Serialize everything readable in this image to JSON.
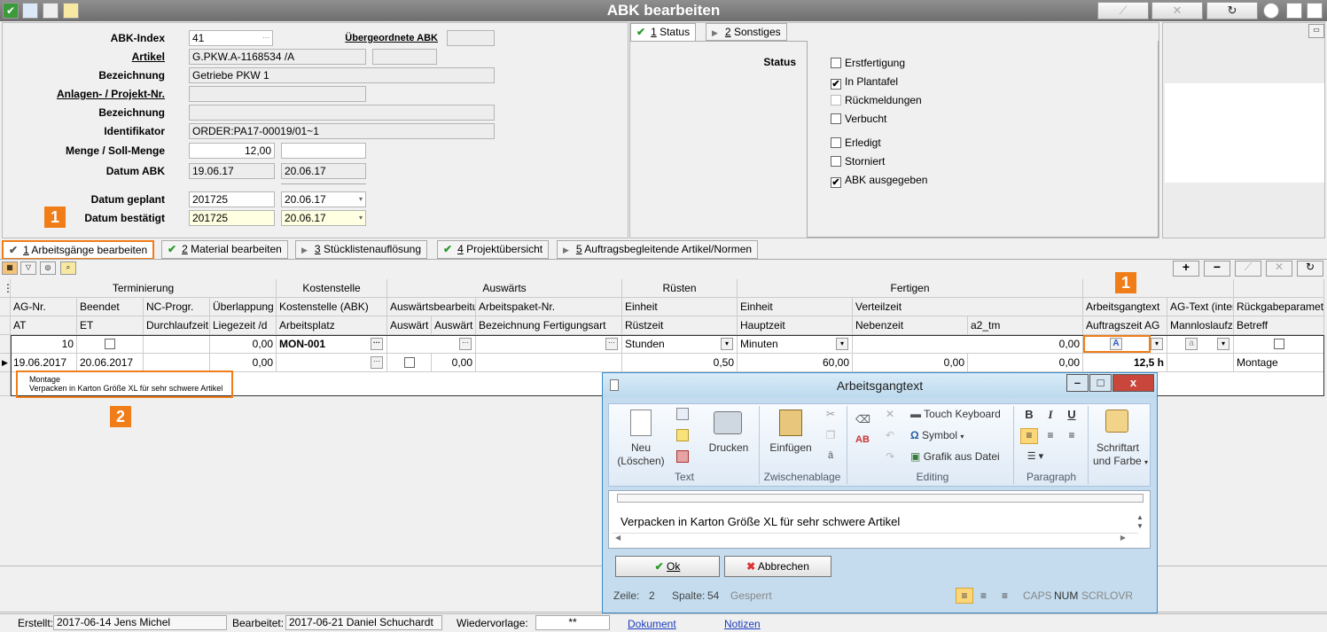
{
  "window": {
    "title": "ABK bearbeiten"
  },
  "form": {
    "abk_index_label": "ABK-Index",
    "abk_index_value": "41",
    "uebergeordnete_label": "Übergeordnete ABK",
    "artikel_label": "Artikel",
    "artikel_value": "G.PKW.A-1168534 /A",
    "bezeichnung_label": "Bezeichnung",
    "bezeichnung_value": "Getriebe PKW 1",
    "anlagen_label": "Anlagen- / Projekt-Nr.",
    "bezeichnung2_label": "Bezeichnung",
    "identifikator_label": "Identifikator",
    "identifikator_value": "ORDER:PA17-00019/01~1",
    "menge_label": "Menge / Soll-Menge",
    "menge_value": "12,00",
    "datum_abk_label": "Datum ABK",
    "datum_abk_1": "19.06.17",
    "datum_abk_2": "20.06.17",
    "datum_geplant_label": "Datum geplant",
    "datum_geplant_1": "201725",
    "datum_geplant_2": "20.06.17",
    "datum_bestaetigt_label": "Datum bestätigt",
    "datum_bestaetigt_1": "201725",
    "datum_bestaetigt_2": "20.06.17",
    "ellipsis": "···"
  },
  "status_tabs": [
    {
      "num": "1",
      "label": " Status"
    },
    {
      "num": "2",
      "label": " Sonstiges"
    }
  ],
  "status": {
    "label": "Status",
    "items": [
      {
        "label": "Erstfertigung",
        "checked": ""
      },
      {
        "label": "In Plantafel",
        "checked": "✔"
      },
      {
        "label": "Rückmeldungen",
        "checked": ""
      },
      {
        "label": "Verbucht",
        "checked": ""
      },
      {
        "label": "Erledigt",
        "checked": ""
      },
      {
        "label": "Storniert",
        "checked": ""
      },
      {
        "label": "ABK ausgegeben",
        "checked": "✔"
      }
    ]
  },
  "main_tabs": [
    {
      "num": "1",
      "label": " Arbeitsgänge bearbeiten"
    },
    {
      "num": "2",
      "label": " Material bearbeiten"
    },
    {
      "num": "3",
      "label": " Stücklistenauflösung"
    },
    {
      "num": "4",
      "label": " Projektübersicht"
    },
    {
      "num": "5",
      "label": " Auftragsbegleitende Artikel/Normen"
    }
  ],
  "grid": {
    "groups": [
      "Terminierung",
      "Kostenstelle",
      "Auswärts",
      "Rüsten",
      "Fertigen"
    ],
    "h1": [
      "AG-Nr.",
      "Beendet",
      "NC-Progr.",
      "Überlappung",
      "Kostenstelle (ABK)",
      "Auswärtsbearbeitung",
      "Arbeitspaket-Nr.",
      "Einheit",
      "Einheit",
      "Verteilzeit",
      "",
      "Arbeitsgangtext",
      "AG-Text (intern)",
      "Rückgabeparameter"
    ],
    "h2": [
      "AT",
      "ET",
      "Durchlaufzeit",
      "Liegezeit /d",
      "Arbeitsplatz",
      "Auswärt",
      "Auswärt",
      "Bezeichnung Fertigungsart",
      "Rüstzeit",
      "Hauptzeit",
      "Nebenzeit",
      "a2_tm",
      "Auftragszeit AG",
      "Mannloslaufzeit",
      "Betreff"
    ],
    "r1": {
      "ag": "10",
      "ueberlappung": "0,00",
      "kostenstelle": "MON-001",
      "ruest_einheit": "Stunden",
      "fert_einheit": "Minuten",
      "verteil": "0,00"
    },
    "r2": {
      "at": "19.06.2017",
      "et": "20.06.2017",
      "liegezeit": "0,00",
      "auswaerts": "0,00",
      "ruestzeit": "0,50",
      "hauptzeit": "60,00",
      "nebenzeit": "0,00",
      "a2": "0,00",
      "auftragszeit": "12,5 h",
      "betreff": "Montage"
    },
    "text_line1": "Montage",
    "text_line2": "Verpacken in Karton Größe XL für sehr schwere Artikel"
  },
  "markers": {
    "m1a": "1",
    "m1b": "1",
    "m2": "2"
  },
  "dialog": {
    "title": "Arbeitsgangtext",
    "neu": "Neu",
    "loeschen": "(Löschen)",
    "drucken": "Drucken",
    "einfuegen": "Einfügen",
    "touch": "Touch Keyboard",
    "symbol": "Symbol",
    "grafik": "Grafik aus Datei",
    "schriftart": "Schriftart",
    "farbe": "und Farbe",
    "groups": {
      "text": "Text",
      "zwischenablage": "Zwischenablage",
      "editing": "Editing",
      "paragraph": "Paragraph"
    },
    "bold": "B",
    "italic": "I",
    "underline": "U",
    "content": "Verpacken in Karton Größe XL für sehr schwere Artikel",
    "ok": "Ok",
    "abbrechen": "Abbrechen",
    "status": {
      "zeile_label": "Zeile:",
      "zeile": "2",
      "spalte_label": "Spalte:",
      "spalte": "54",
      "gesperrt": "Gesperrt",
      "caps": "CAPS",
      "num": "NUM",
      "scrl": "SCRL",
      "ovr": "OVR"
    }
  },
  "footer": {
    "erstellt_label": "Erstellt:",
    "erstellt": "2017-06-14  Jens Michel",
    "bearbeitet_label": "Bearbeitet:",
    "bearbeitet": "2017-06-21  Daniel Schuchardt",
    "wiedervorlage_label": "Wiedervorlage:",
    "wiedervorlage": "**",
    "dokument": "Dokument",
    "notizen": "Notizen"
  },
  "colors": {
    "accent": "#f07d18",
    "title_bar": "#7a7a7a",
    "dialog_border": "#3a8ac9",
    "check_green": "#2a9a2a",
    "link": "#1a3cbd"
  }
}
